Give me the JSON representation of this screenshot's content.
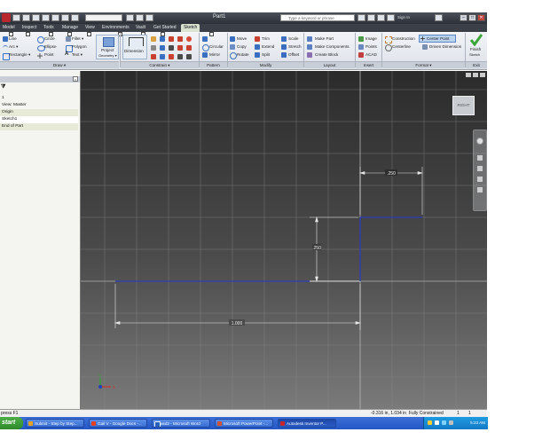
{
  "window": {
    "title": "Part1",
    "search_placeholder": "Type a keyword or phrase",
    "sign_in": "Sign In",
    "min_glyph": "–",
    "max_glyph": "□",
    "close_glyph": "✕"
  },
  "tabs": [
    {
      "label": "Model",
      "key": ""
    },
    {
      "label": "Inspect",
      "key": ""
    },
    {
      "label": "Tools",
      "key": ""
    },
    {
      "label": "Manage",
      "key": ""
    },
    {
      "label": "View",
      "key": ""
    },
    {
      "label": "Environments",
      "key": ""
    },
    {
      "label": "Vault",
      "key": ""
    },
    {
      "label": "Get Started",
      "key": ""
    },
    {
      "label": "Sketch",
      "key": ""
    }
  ],
  "ribbon": {
    "draw": {
      "panel_label": "Draw ▾",
      "line": "Line",
      "circle": "Circle",
      "arc": "Arc ▾",
      "ellipse": "Ellipse",
      "rectangle": "Rectangle ▾",
      "point": "Point",
      "fillet": "Fillet ▾",
      "polygon": "Polygon",
      "text": "Text ▾",
      "project_geometry_1": "Project",
      "project_geometry_2": "Geometry ▾"
    },
    "constrain": {
      "panel_label": "Constrain ▾",
      "dimension": "Dimension"
    },
    "pattern": {
      "panel_label": "Pattern",
      "rectangular": "",
      "circular": "Circular",
      "mirror": "Mirror"
    },
    "modify": {
      "panel_label": "Modify",
      "move": "Move",
      "copy": "Copy",
      "rotate": "Rotate",
      "trim": "Trim",
      "extend": "Extend",
      "split": "Split",
      "scale": "Scale",
      "stretch": "Stretch",
      "offset": "Offset"
    },
    "layout": {
      "panel_label": "Layout",
      "make_part": "Make Part",
      "make_components": "Make Components",
      "create_block": "Create Block"
    },
    "insert": {
      "panel_label": "Insert",
      "image": "Image",
      "points": "Points",
      "acad": "ACAD"
    },
    "format": {
      "panel_label": "Format ▾",
      "construction": "Construction",
      "center_point": "Center Point",
      "centerline": "Centerline",
      "driven_dimension": "Driven Dimension"
    },
    "exit": {
      "panel_label": "Exit",
      "finish_1": "Finish",
      "finish_2": "Sketch"
    }
  },
  "browser": {
    "filter_icon": "filter-icon",
    "items": [
      {
        "label": "1"
      },
      {
        "label": "View: Master"
      },
      {
        "label": "Origin"
      },
      {
        "label": "Sketch1"
      },
      {
        "label": "End of Part"
      }
    ]
  },
  "sketch": {
    "dim_width": "1.000",
    "dim_height": ".250",
    "dim_step": ".250"
  },
  "viewcube": {
    "label": "RIGHT"
  },
  "axis": {
    "x": "X",
    "y": "Y"
  },
  "status": {
    "message": "press F1",
    "coords": "-0.316 in, 1.034 in",
    "constraint": "Fully Constrained",
    "n1": "1",
    "n2": "1"
  },
  "taskbar": {
    "start": "start",
    "items": [
      {
        "label": "Submit - Step by Step...",
        "color": "#e8a020"
      },
      {
        "label": "Gail V - Google Docs -...",
        "color": "#e84020"
      },
      {
        "label": "asd2 - Microsoft Word",
        "color": "#2b5fbd"
      },
      {
        "label": "Microsoft PowerPoint -...",
        "color": "#d35230"
      },
      {
        "label": "Autodesk Inventor P...",
        "color": "#c8262d"
      }
    ],
    "clock": "5:23 AM"
  }
}
